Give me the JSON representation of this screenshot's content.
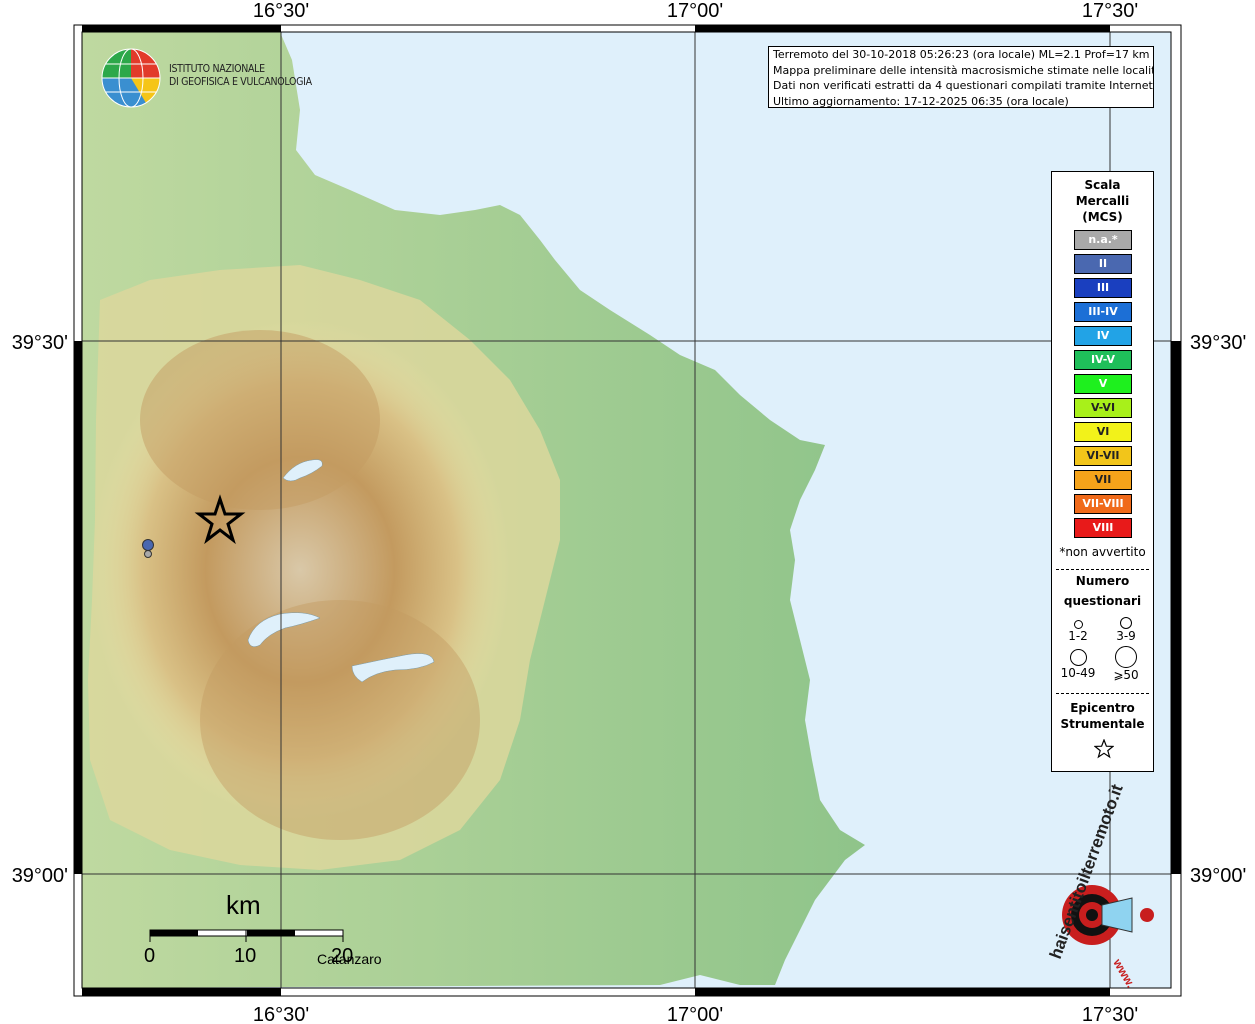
{
  "title": {
    "line1": "Terremoto del 30-10-2018 05:26:23 (ora locale) ML=2.1 Prof=17 km",
    "line2": "Mappa preliminare delle intensità macrosismiche stimate nelle località",
    "line3": "Dati non verificati estratti da 4 questionari compilati tramite Internet.",
    "line4": "Ultimo aggiornamento: 17-12-2025 06:35 (ora locale)"
  },
  "logo": {
    "line1": "ISTITUTO NAZIONALE",
    "line2": "DI GEOFISICA E VULCANOLOGIA",
    "icon": "ingv-globe-icon"
  },
  "axes": {
    "top": [
      "16°30'",
      "17°00'",
      "17°30'"
    ],
    "bottom": [
      "16°30'",
      "17°00'",
      "17°30'"
    ],
    "left": [
      "39°30'",
      "39°00'"
    ],
    "right": [
      "39°30'",
      "39°00'"
    ]
  },
  "legend": {
    "title_line1": "Scala",
    "title_line2": "Mercalli",
    "title_line3": "(MCS)",
    "items": [
      {
        "label": "n.a.*",
        "color": "#a9a9a9"
      },
      {
        "label": "II",
        "color": "#4a68b0"
      },
      {
        "label": "III",
        "color": "#1a3fbf"
      },
      {
        "label": "III-IV",
        "color": "#1c6fd6"
      },
      {
        "label": "IV",
        "color": "#22a3e6"
      },
      {
        "label": "IV-V",
        "color": "#1fbf5a"
      },
      {
        "label": "V",
        "color": "#1ef01e"
      },
      {
        "label": "V-VI",
        "color": "#a8f01a"
      },
      {
        "label": "VI",
        "color": "#f2f21a"
      },
      {
        "label": "VI-VII",
        "color": "#f2c51a"
      },
      {
        "label": "VII",
        "color": "#f5a31a"
      },
      {
        "label": "VII-VIII",
        "color": "#f06a1a"
      },
      {
        "label": "VIII",
        "color": "#e81a1a"
      }
    ],
    "na_note": "*non avvertito",
    "questionnaires_line1": "Numero",
    "questionnaires_line2": "questionari",
    "q_labels": [
      "1-2",
      "3-9",
      "10-49",
      "⩾50"
    ],
    "epicenter_line1": "Epicentro",
    "epicenter_line2": "Strumentale",
    "epicenter_icon": "star-icon"
  },
  "scalebar": {
    "unit": "km",
    "labels": [
      "0",
      "10",
      "20"
    ]
  },
  "places": {
    "catanzaro": "Catanzaro"
  },
  "observations": [
    {
      "intensity": "II",
      "questionnaires": "3-9",
      "color": "#4a68b0"
    },
    {
      "intensity": "n.a.*",
      "questionnaires": "1-2",
      "color": "#a9a9a9"
    }
  ],
  "watermark": {
    "text": "haisentitoilterremoto.it",
    "url_text": "www."
  },
  "colors": {
    "sea": "#dff0fb",
    "lowland": "#9fcf95",
    "hills": "#e8deaa",
    "mountains": "#c9a36a"
  }
}
